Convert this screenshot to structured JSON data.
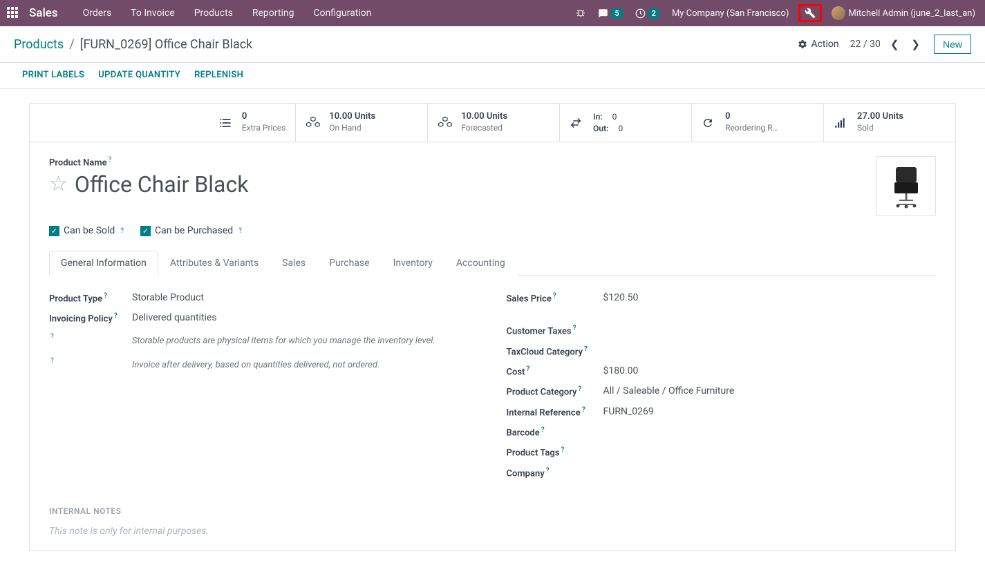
{
  "nav": {
    "brand": "Sales",
    "items": [
      "Orders",
      "To Invoice",
      "Products",
      "Reporting",
      "Configuration"
    ],
    "chat_badge": "5",
    "activity_badge": "2",
    "company": "My Company (San Francisco)",
    "user": "Mitchell Admin (june_2_last_an)"
  },
  "breadcrumb": {
    "root": "Products",
    "current": "[FURN_0269] Office Chair Black"
  },
  "bar": {
    "action": "Action",
    "pager": "22 / 30",
    "new": "New"
  },
  "actions": {
    "print": "PRINT LABELS",
    "update": "UPDATE QUANTITY",
    "replenish": "REPLENISH"
  },
  "stats": {
    "extra": {
      "val": "0",
      "lbl": "Extra Prices"
    },
    "onhand": {
      "val": "10.00 Units",
      "lbl": "On Hand"
    },
    "forecast": {
      "val": "10.00 Units",
      "lbl": "Forecasted"
    },
    "in_lbl": "In:",
    "in_val": "0",
    "out_lbl": "Out:",
    "out_val": "0",
    "reorder": {
      "val": "0",
      "lbl": "Reordering R…"
    },
    "sold": {
      "val": "27.00 Units",
      "lbl": "Sold"
    }
  },
  "product": {
    "name_label": "Product Name",
    "name": "Office Chair Black",
    "can_be_sold": "Can be Sold",
    "can_be_purchased": "Can be Purchased"
  },
  "tabs": [
    "General Information",
    "Attributes & Variants",
    "Sales",
    "Purchase",
    "Inventory",
    "Accounting"
  ],
  "fields": {
    "product_type": {
      "label": "Product Type",
      "value": "Storable Product"
    },
    "invoicing_policy": {
      "label": "Invoicing Policy",
      "value": "Delivered quantities"
    },
    "help1": "Storable products are physical items for which you manage the inventory level.",
    "help2": "Invoice after delivery, based on quantities delivered, not ordered.",
    "sales_price": {
      "label": "Sales Price",
      "value": "$120.50"
    },
    "customer_taxes": {
      "label": "Customer Taxes",
      "value": ""
    },
    "taxcloud": {
      "label": "TaxCloud Category",
      "value": ""
    },
    "cost": {
      "label": "Cost",
      "value": "$180.00"
    },
    "product_category": {
      "label": "Product Category",
      "value": "All / Saleable / Office Furniture"
    },
    "internal_ref": {
      "label": "Internal Reference",
      "value": "FURN_0269"
    },
    "barcode": {
      "label": "Barcode",
      "value": ""
    },
    "product_tags": {
      "label": "Product Tags",
      "value": ""
    },
    "company": {
      "label": "Company",
      "value": ""
    }
  },
  "notes": {
    "title": "INTERNAL NOTES",
    "placeholder": "This note is only for internal purposes."
  }
}
